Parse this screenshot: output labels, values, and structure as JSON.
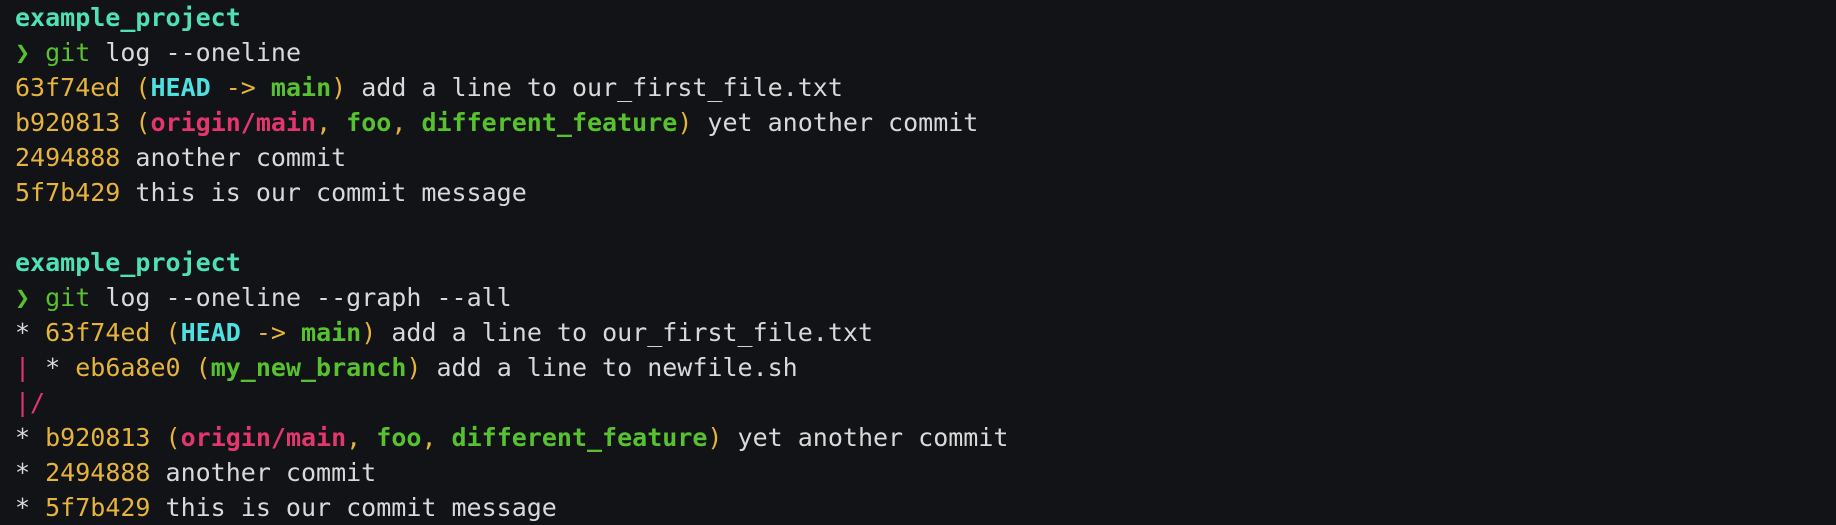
{
  "colors": {
    "background": "#111316",
    "directory": "#4fe0b4",
    "command": "#57c12f",
    "hash": "#e6b43c",
    "head": "#4fe0e0",
    "local_branch": "#57c12f",
    "remote_branch": "#e2366c",
    "text": "#d9d9d9",
    "graph_line": "#e2366c"
  },
  "session1": {
    "directory": "example_project",
    "prompt_char": "❯",
    "command": "git",
    "args": " log --oneline",
    "commits": [
      {
        "hash": "63f74ed",
        "head": "HEAD",
        "arrow": " -> ",
        "branch": "main",
        "message": " add a line to our_first_file.txt"
      },
      {
        "hash": "b920813",
        "remote": "origin/main",
        "branch1": "foo",
        "branch2": "different_feature",
        "message": " yet another commit"
      },
      {
        "hash": "2494888",
        "message": " another commit"
      },
      {
        "hash": "5f7b429",
        "message": " this is our commit message"
      }
    ]
  },
  "session2": {
    "directory": "example_project",
    "prompt_char": "❯",
    "command": "git",
    "args": " log --oneline --graph --all",
    "lines": [
      {
        "graph": "* ",
        "hash": "63f74ed",
        "head": "HEAD",
        "arrow": " -> ",
        "branch": "main",
        "message": " add a line to our_first_file.txt"
      },
      {
        "graph_pipe": "| ",
        "graph": "* ",
        "hash": "eb6a8e0",
        "branch": "my_new_branch",
        "message": " add a line to newfile.sh"
      },
      {
        "graph_pipe": "|/"
      },
      {
        "graph": "* ",
        "hash": "b920813",
        "remote": "origin/main",
        "branch1": "foo",
        "branch2": "different_feature",
        "message": " yet another commit"
      },
      {
        "graph": "* ",
        "hash": "2494888",
        "message": " another commit"
      },
      {
        "graph": "* ",
        "hash": "5f7b429",
        "message": " this is our commit message"
      }
    ]
  }
}
